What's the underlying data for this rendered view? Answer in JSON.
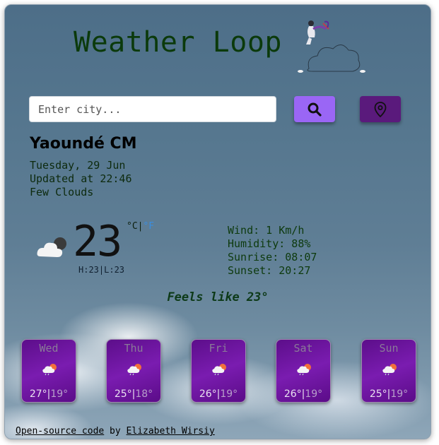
{
  "app_title": "Weather Loop",
  "search": {
    "placeholder": "Enter city..."
  },
  "buttons": {
    "search_icon": "search-icon",
    "location_icon": "location-pin-icon"
  },
  "location": {
    "city": "Yaoundé CM",
    "date": "Tuesday, 29 Jun",
    "updated": "Updated at 22:46",
    "condition": "Few Clouds"
  },
  "current": {
    "temperature": "23",
    "unit_c": "°C",
    "unit_sep": "|",
    "unit_f": "°F",
    "hilo": "H:23|L:23",
    "feels_like": "Feels like 23°",
    "icon": "partly-cloudy-night-icon"
  },
  "stats": {
    "wind": "Wind: 1 Km/h",
    "humidity": "Humidity: 88%",
    "sunrise": "Sunrise: 08:07",
    "sunset": "Sunset: 20:27"
  },
  "forecast": [
    {
      "day": "Wed",
      "high": "27°",
      "low": "19°",
      "icon": "sun-cloud-rain-icon"
    },
    {
      "day": "Thu",
      "high": "25°",
      "low": "18°",
      "icon": "sun-cloud-rain-icon"
    },
    {
      "day": "Fri",
      "high": "26°",
      "low": "19°",
      "icon": "sun-cloud-rain-icon"
    },
    {
      "day": "Sat",
      "high": "26°",
      "low": "19°",
      "icon": "sun-cloud-rain-icon"
    },
    {
      "day": "Sun",
      "high": "25°",
      "low": "19°",
      "icon": "sun-cloud-rain-icon"
    }
  ],
  "footer": {
    "link_code": "Open-source code",
    "by": " by ",
    "link_author": "Elizabeth Wirsiy"
  },
  "colors": {
    "search_button": "#9a66f5",
    "location_button": "#5a1a7c",
    "forecast_card": "#6a14a0",
    "title": "#0b3a0b"
  }
}
